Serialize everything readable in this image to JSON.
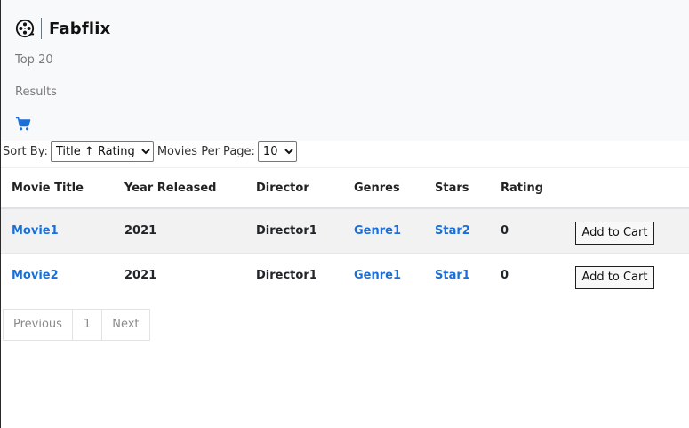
{
  "brand": {
    "name": "Fabflix",
    "logo_icon": "film-reel-icon"
  },
  "nav": {
    "top20": "Top 20",
    "results": "Results",
    "cart_icon": "shopping-cart-icon"
  },
  "controls": {
    "sort_label": "Sort By:",
    "sort_value": "Title ↑ Rating ↓",
    "per_page_label": "Movies Per Page:",
    "per_page_value": "10"
  },
  "table": {
    "headers": [
      "Movie Title",
      "Year Released",
      "Director",
      "Genres",
      "Stars",
      "Rating"
    ],
    "rows": [
      {
        "title": "Movie1",
        "year": "2021",
        "director": "Director1",
        "genres": "Genre1",
        "stars": "Star2",
        "rating": "0",
        "action": "Add to Cart"
      },
      {
        "title": "Movie2",
        "year": "2021",
        "director": "Director1",
        "genres": "Genre1",
        "stars": "Star1",
        "rating": "0",
        "action": "Add to Cart"
      }
    ]
  },
  "pagination": {
    "previous": "Previous",
    "current": "1",
    "next": "Next"
  },
  "colors": {
    "link": "#1a6fd8",
    "navbar_bg": "#f8f9fa",
    "striped_row": "#f2f2f2"
  }
}
